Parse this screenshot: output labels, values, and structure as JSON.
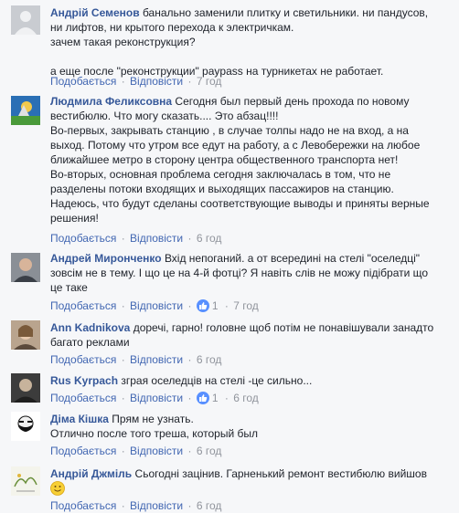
{
  "labels": {
    "reply": "Подобається",
    "sep": "·",
    "reply_alt": "Відповісти"
  },
  "comments": [
    {
      "author": "Андрій Семенов",
      "lines": [
        "банально заменили плитку и светильники. ни пандусов,",
        "ни лифтов, ни крытого перехода к электричкам.",
        "зачем такая реконструкция?",
        "",
        "а еще после \"реконструкции\" paypass на турникетах не работает."
      ],
      "time": "7 год",
      "likes": null,
      "avatar_icon": "user-avatar-placeholder"
    },
    {
      "author": "Людмила Феликсовна",
      "first": "Сегодня был первый день прохода по новому",
      "lines": [
        "вестибюлю. Что могу сказать.... Это абзац!!!!",
        "Во-первых, закрывать станцию , в случае толпы надо не на вход, а на",
        "выход. Потому что утром все едут на работу, а с Левобережки на любое",
        "ближайшее метро в сторону центра общественного транспорта нет!",
        "Во-вторых, основная проблема сегодня заключалась в том, что не",
        "разделены потоки входящих и выходящих пассажиров на станцию.",
        "Надеюсь, что будут сделаны соответствующие выводы и приняты верные",
        "решения!"
      ],
      "time": "6 год",
      "likes": null,
      "avatar_icon": "cartoon-avatar"
    },
    {
      "author": "Андрей Миронченко",
      "first": "Вхід непоганий. а от всередині на стелі \"оселедці\"",
      "lines": [
        "зовсім не в тему. І що це на 4-й фотці? Я навіть слів не можу підібрати що",
        "це таке"
      ],
      "time": "7 год",
      "likes": "1",
      "avatar_icon": "person-avatar"
    },
    {
      "author": "Ann Kadnikova",
      "first": "доречі, гарно! головне щоб потім не понавішували занадто",
      "lines": [
        "багато реклами"
      ],
      "time": "6 год",
      "likes": null,
      "avatar_icon": "person-avatar"
    },
    {
      "author": "Rus Kyrpach",
      "first": "зграя оселедців на стелі -це сильно...",
      "lines": [],
      "time": "6 год",
      "likes": "1",
      "avatar_icon": "person-avatar"
    },
    {
      "author": "Діма Кішка",
      "first": "Прям не узнать.",
      "lines": [
        "Отлично после того треша, который был"
      ],
      "time": "6 год",
      "likes": null,
      "avatar_icon": "bearded-avatar"
    },
    {
      "author": "Андрій Джміль",
      "first": "Сьогодні зацінив. Гарненький ремонт вестибюлю вийшов",
      "lines": [],
      "time": "6 год",
      "likes": null,
      "emoji": "smiley-icon",
      "avatar_icon": "sketch-avatar"
    }
  ]
}
